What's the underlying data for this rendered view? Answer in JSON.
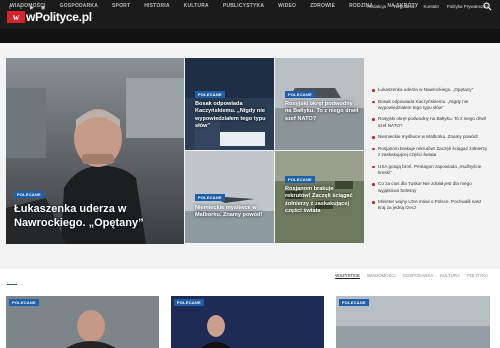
{
  "topbar": {
    "social_icons": [
      "facebook-icon",
      "twitter-icon",
      "youtube-icon",
      "rss-icon"
    ],
    "links": [
      "Redakcja",
      "Regulamin",
      "Kontakt",
      "Polityka Prywatności"
    ]
  },
  "brand": {
    "mark": "w",
    "name": "wPolityce.pl",
    "accent": "#d6262d"
  },
  "nav": {
    "items": [
      "WIADOMOŚCI",
      "GOSPODARKA",
      "SPORT",
      "HISTORIA",
      "KULTURA",
      "PUBLICYSTYKA",
      "WIDEO",
      "ZDROWIE",
      "RODZINA",
      "NA SKRÓTY"
    ]
  },
  "hero": {
    "main": {
      "badge": "POLECANE",
      "title": "Łukaszenka uderza w Nawrockiego. „Opętany”"
    },
    "tiles": [
      {
        "badge": "POLECANE",
        "title": "Bosak odpowiada Kaczyńskiemu. „Nigdy nie wypowiedziałem tego typu słów”"
      },
      {
        "badge": "POLECANE",
        "title": "Rosyjski okręt podwodny na Bałtyku. To z niego drwił szef NATO?"
      },
      {
        "badge": "POLECANE",
        "title": "Niemieckie myśliwce w Malborku. Znamy powód!"
      },
      {
        "badge": "POLECANE",
        "title": "Rosjanom brakuje rekrutów! Zaczęli ściągać żołnierzy z zaskakującej części świata"
      }
    ],
    "sidebar": [
      "Łukaszenka uderza w Nawrockiego. „Opętany”",
      "Bosak odpowiada Kaczyńskiemu. „Nigdy nie wypowiedziałem tego typu słów”",
      "Rosyjski okręt podwodny na Bałtyku. To z niego drwił szef NATO?",
      "Niemieckie myśliwce w Malborku. Znamy powód!",
      "Rosjanom brakuje rekrutów! Zaczęli ściągać żołnierzy z zaskakującej części świata",
      "USA gotują broń. Pentagon zapowiada „mużbyście kreski”",
      "Co za cios dla Tuska! Nie zdołał jest dla mego wyjątkowo bolesny",
      "Minister wojny USA mówi o Polsce. Pochwalił nasz kraj za jedną rzecz"
    ]
  },
  "tabs": [
    "WSZYSTKIE",
    "WIADOMOŚCI",
    "GOSPODARKA",
    "KULTURA",
    "POLITYKA"
  ],
  "bottom": {
    "badges": [
      "POLECANE",
      "POLECANE",
      "POLECANE"
    ]
  }
}
